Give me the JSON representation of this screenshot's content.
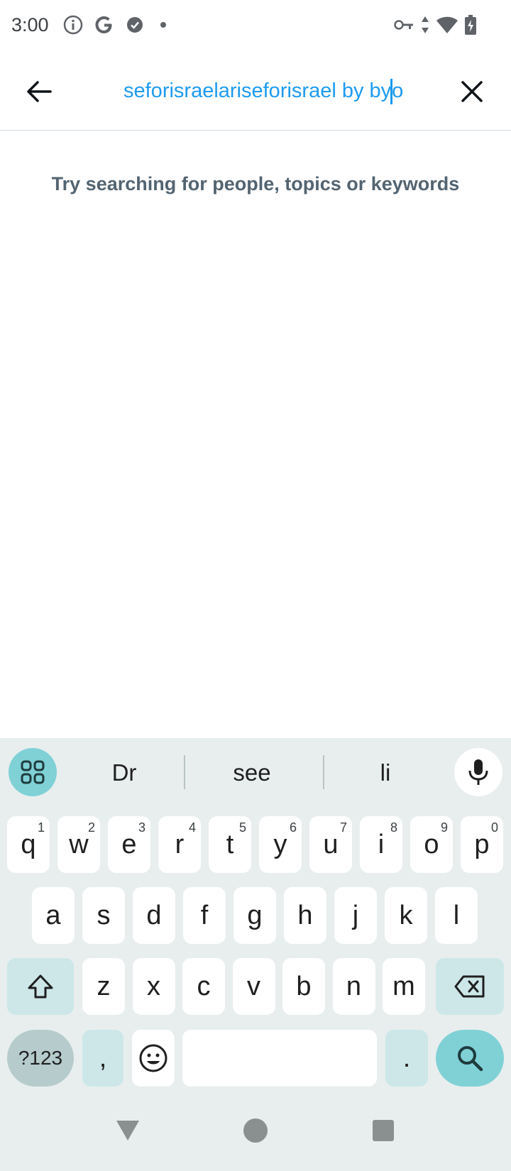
{
  "status_bar": {
    "time": "3:00",
    "left_icons": [
      "info-icon",
      "google-icon",
      "check-badge-icon",
      "dot-icon"
    ],
    "right_icons": [
      "vpn-key-icon",
      "data-arrows-icon",
      "wifi-icon",
      "battery-charging-icon"
    ]
  },
  "search": {
    "query": "seforisraelariseforisrael by by",
    "query_after_caret": "o",
    "back_icon": "arrow-left-icon",
    "clear_icon": "close-icon",
    "accent_color": "#1d9bf0"
  },
  "empty_state": {
    "hint": "Try searching for people, topics or keywords"
  },
  "keyboard": {
    "suggestions": [
      "Dr",
      "see",
      "li"
    ],
    "row1": [
      {
        "key": "q",
        "hint": "1"
      },
      {
        "key": "w",
        "hint": "2"
      },
      {
        "key": "e",
        "hint": "3"
      },
      {
        "key": "r",
        "hint": "4"
      },
      {
        "key": "t",
        "hint": "5"
      },
      {
        "key": "y",
        "hint": "6"
      },
      {
        "key": "u",
        "hint": "7"
      },
      {
        "key": "i",
        "hint": "8"
      },
      {
        "key": "o",
        "hint": "9"
      },
      {
        "key": "p",
        "hint": "0"
      }
    ],
    "row2": [
      "a",
      "s",
      "d",
      "f",
      "g",
      "h",
      "j",
      "k",
      "l"
    ],
    "row3": [
      "z",
      "x",
      "c",
      "v",
      "b",
      "n",
      "m"
    ],
    "symbols_label": "?123",
    "comma_label": ",",
    "period_label": ".",
    "accent_color": "#7fd1d6"
  },
  "nav_bar": {
    "icons": [
      "back-triangle-icon",
      "home-circle-icon",
      "recents-square-icon"
    ]
  }
}
